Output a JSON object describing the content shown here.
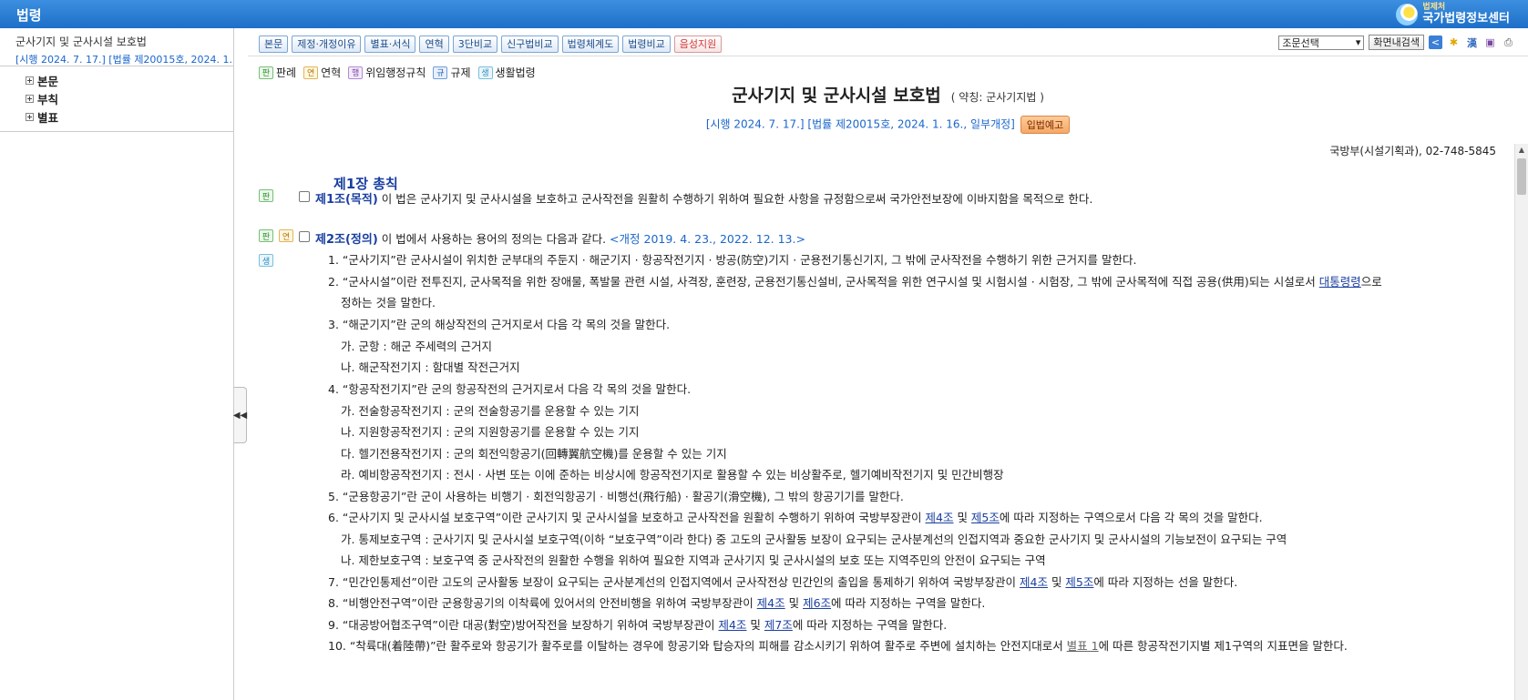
{
  "app": {
    "title": "법령",
    "brand_small": "법제처",
    "brand_large": "국가법령정보센터"
  },
  "left": {
    "law_name": "군사기지 및 군사시설 보호법",
    "law_date": "[시행 2024. 7. 17.] [법률 제20015호, 2024. 1. 16., 일부개정]",
    "tree": [
      "본문",
      "부칙",
      "별표"
    ],
    "collapse_glyph": "◀◀"
  },
  "toolbar": {
    "buttons": [
      "본문",
      "제정·개정이유",
      "별표·서식",
      "연혁",
      "3단비교",
      "신구법비교",
      "법령체계도",
      "법령비교",
      "음성지원"
    ],
    "select_label": "조문선택",
    "search_label": "화면내검색"
  },
  "legend": [
    {
      "badge": "판",
      "label": "판례"
    },
    {
      "badge": "연",
      "label": "연혁"
    },
    {
      "badge": "행",
      "label": "위임행정규칙"
    },
    {
      "badge": "규",
      "label": "규제"
    },
    {
      "badge": "생",
      "label": "생활법령"
    }
  ],
  "law": {
    "title": "군사기지 및 군사시설 보호법",
    "short_name": "( 약칭: 군사기지법 )",
    "enforcement": "[시행 2024. 7. 17.] [법률 제20015호, 2024. 1. 16., 일부개정]",
    "notice_button": "입법예고",
    "department": "국방부(시설기획과), 02-748-5845"
  },
  "body": {
    "chapter": "제1장 총칙",
    "art1_head": "제1조(목적)",
    "art1_text": " 이 법은 군사기지 및 군사시설을 보호하고 군사작전을 원활히 수행하기 위하여 필요한 사항을 규정함으로써 국가안전보장에 이바지함을 목적으로 한다.",
    "art2_head": "제2조(정의)",
    "art2_text": " 이 법에서 사용하는 용어의 정의는 다음과 같다.",
    "art2_amend": " <개정 2019. 4. 23., 2022. 12. 13.>",
    "i1": "1. “군사기지”란 군사시설이 위치한 군부대의 주둔지 · 해군기지 · 항공작전기지 · 방공(防空)기지 · 군용전기통신기지, 그 밖에 군사작전을 수행하기 위한 근거지를 말한다.",
    "i2a": "2. “군사시설”이란 전투진지, 군사목적을 위한 장애물, 폭발물 관련 시설, 사격장, 훈련장, 군용전기통신설비, 군사목적을 위한 연구시설 및 시험시설 · 시험장, 그 밖에 군사목적에 직접 공용(供用)되는 시설로서 ",
    "i2_link": "대통령령",
    "i2b": "으로",
    "i2c": "정하는 것을 말한다.",
    "i3": "3. “해군기지”란 군의 해상작전의 근거지로서 다음 각 목의 것을 말한다.",
    "i3ga": "가. 군항 : 해군 주세력의 근거지",
    "i3na": "나. 해군작전기지 : 함대별 작전근거지",
    "i4": "4. “항공작전기지”란 군의 항공작전의 근거지로서 다음 각 목의 것을 말한다.",
    "i4ga": "가. 전술항공작전기지 : 군의 전술항공기를 운용할 수 있는 기지",
    "i4na": "나. 지원항공작전기지 : 군의 지원항공기를 운용할 수 있는 기지",
    "i4da": "다. 헬기전용작전기지 : 군의 회전익항공기(回轉翼航空機)를 운용할 수 있는 기지",
    "i4ra": "라. 예비항공작전기지 : 전시 · 사변 또는 이에 준하는 비상시에 항공작전기지로 활용할 수 있는 비상활주로, 헬기예비작전기지 및 민간비행장",
    "i5": "5. “군용항공기”란 군이 사용하는 비행기 · 회전익항공기 · 비행선(飛行船) · 활공기(滑空機), 그 밖의 항공기기를 말한다.",
    "i6a": "6. “군사기지 및 군사시설 보호구역”이란 군사기지 및 군사시설을 보호하고 군사작전을 원활히 수행하기 위하여 국방부장관이 ",
    "i6_l1": "제4조",
    "i6_and": " 및 ",
    "i6_l2": "제5조",
    "i6b": "에 따라 지정하는 구역으로서 다음 각 목의 것을 말한다.",
    "i6ga": "가. 통제보호구역 : 군사기지 및 군사시설 보호구역(이하 “보호구역”이라 한다) 중 고도의 군사활동 보장이 요구되는 군사분계선의 인접지역과 중요한 군사기지 및 군사시설의 기능보전이 요구되는 구역",
    "i6na": "나. 제한보호구역 : 보호구역 중 군사작전의 원활한 수행을 위하여 필요한 지역과 군사기지 및 군사시설의 보호 또는 지역주민의 안전이 요구되는 구역",
    "i7a": "7. “민간인통제선”이란 고도의 군사활동 보장이 요구되는 군사분계선의 인접지역에서 군사작전상 민간인의 출입을 통제하기 위하여 국방부장관이 ",
    "i7_l1": "제4조",
    "i7_and": " 및 ",
    "i7_l2": "제5조",
    "i7b": "에 따라 지정하는 선을 말한다.",
    "i8a": "8. “비행안전구역”이란 군용항공기의 이착륙에 있어서의 안전비행을 위하여 국방부장관이 ",
    "i8_l1": "제4조",
    "i8_and": " 및 ",
    "i8_l2": "제6조",
    "i8b": "에 따라 지정하는 구역을 말한다.",
    "i9a": "9. “대공방어협조구역”이란 대공(對空)방어작전을 보장하기 위하여 국방부장관이 ",
    "i9_l1": "제4조",
    "i9_and": " 및 ",
    "i9_l2": "제7조",
    "i9b": "에 따라 지정하는 구역을 말한다.",
    "i10a": "10. “착륙대(着陸帶)”란 활주로와 항공기가 활주로를 이탈하는 경우에 항공기와 탑승자의 피해를 감소시키기 위하여 활주로 주변에 설치하는 안전지대로서 ",
    "i10_link": "별표 1",
    "i10b": "에 따른 항공작전기지별 제1구역의 지표면을 말한다."
  }
}
